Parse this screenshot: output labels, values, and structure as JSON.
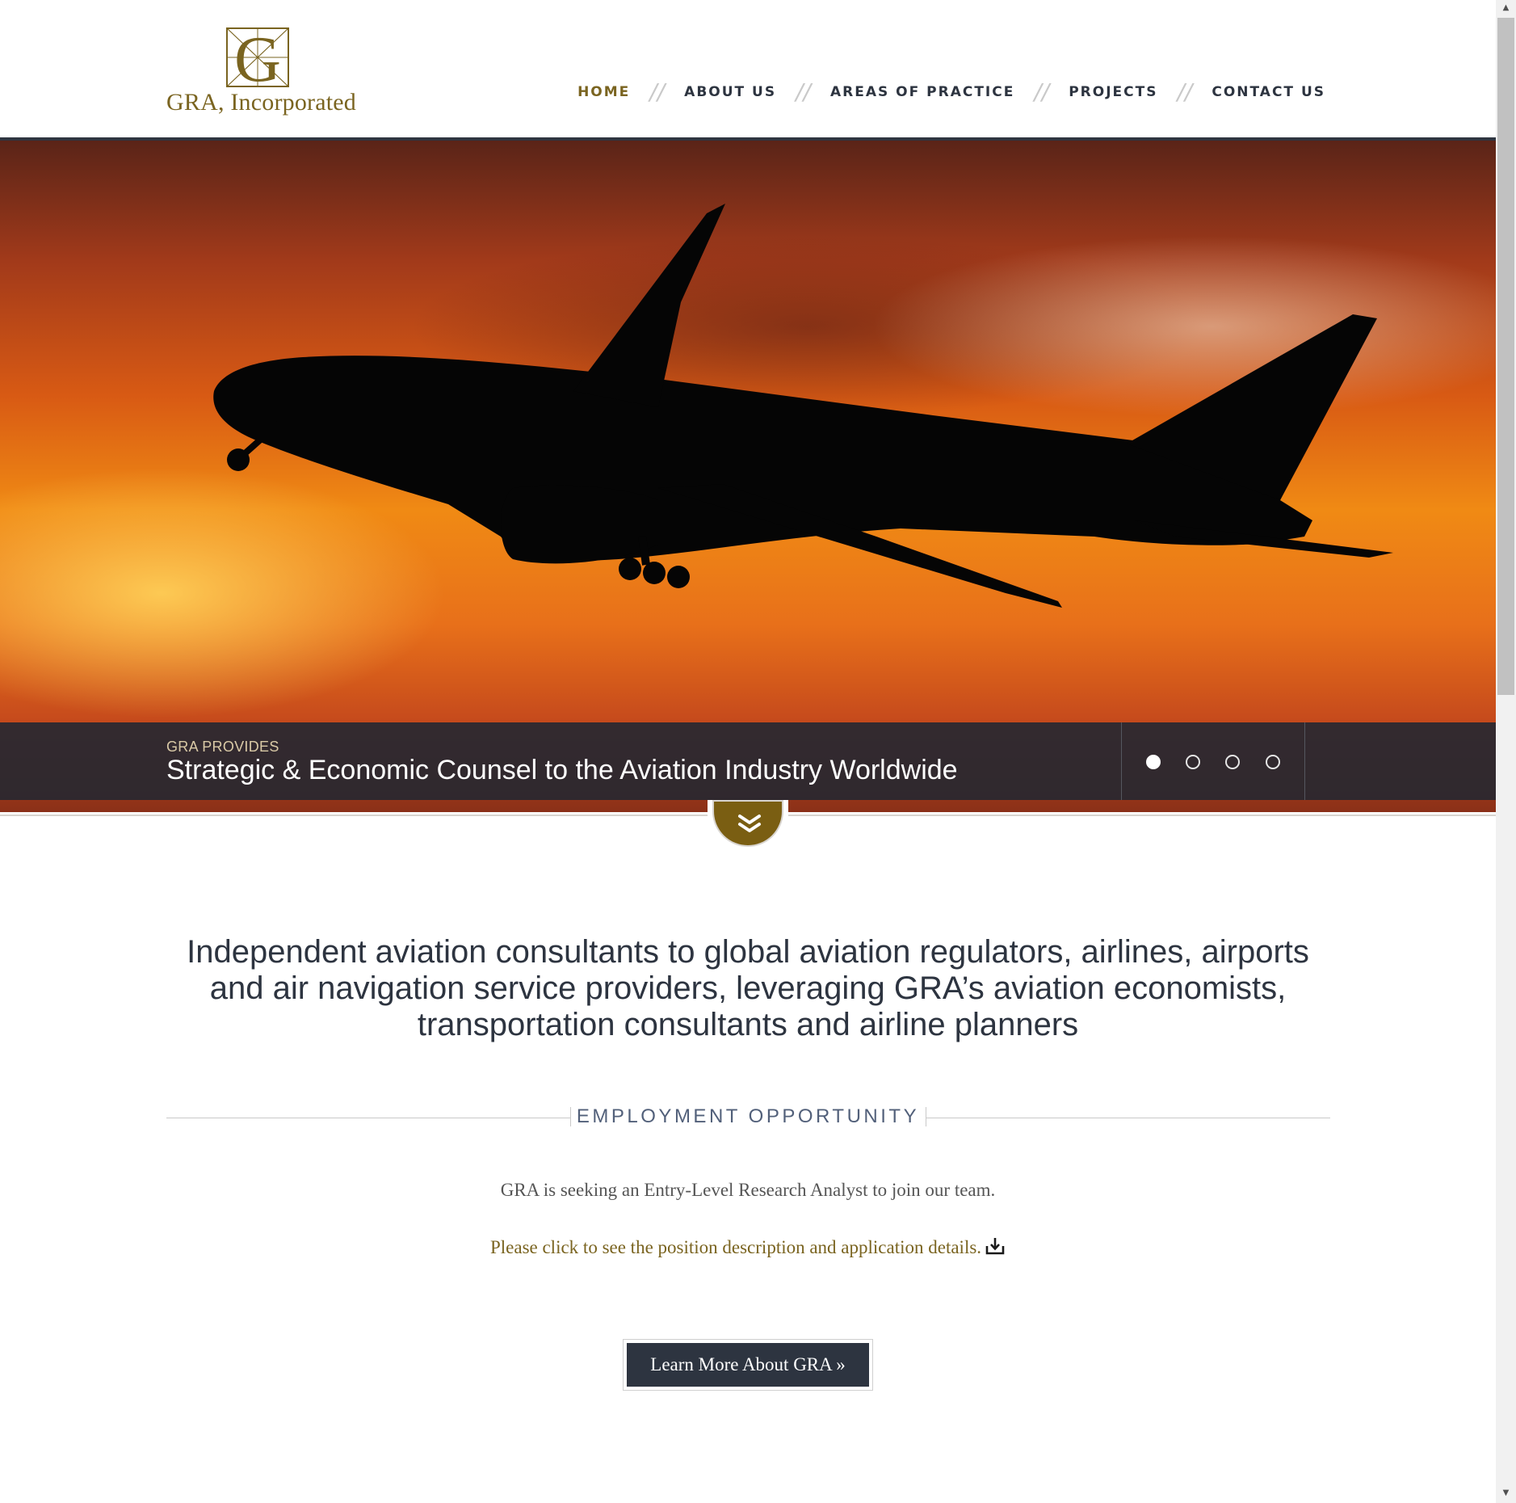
{
  "brand": {
    "name": "GRA, Incorporated",
    "color": "#7a6420"
  },
  "nav": {
    "items": [
      {
        "label": "HOME",
        "active": true
      },
      {
        "label": "ABOUT US",
        "active": false
      },
      {
        "label": "AREAS OF PRACTICE",
        "active": false
      },
      {
        "label": "PROJECTS",
        "active": false
      },
      {
        "label": "CONTACT US",
        "active": false
      }
    ],
    "separator": "//"
  },
  "hero": {
    "caption_small": "GRA PROVIDES",
    "caption_big": "Strategic & Economic Counsel to the Aviation Industry Worldwide",
    "slides": 4,
    "active_slide": 1,
    "scroll_icon": "double-chevron-down-icon"
  },
  "main": {
    "tagline": "Independent aviation consultants to global aviation regulators, airlines, airports and air navigation service providers, leveraging GRA’s aviation economists, transportation consultants and airline planners",
    "employment_title": "EMPLOYMENT OPPORTUNITY",
    "seeking_text": "GRA is seeking an Entry-Level Research Analyst to join our team.",
    "click_text": "Please click to see the position description and application details.",
    "click_icon": "download-icon",
    "learn_button": "Learn More About GRA »"
  },
  "colors": {
    "dark": "#2d3440",
    "gold": "#7a6420",
    "accent_button": "#7a5e12"
  }
}
